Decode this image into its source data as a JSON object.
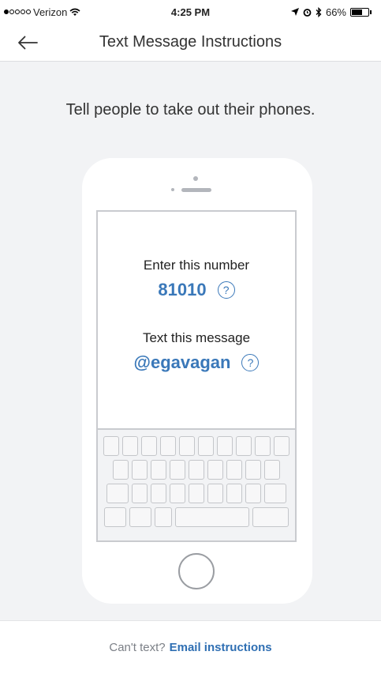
{
  "status_bar": {
    "carrier": "Verizon",
    "time": "4:25 PM",
    "battery": "66%"
  },
  "nav": {
    "title": "Text Message Instructions"
  },
  "headline": "Tell people to take out their phones.",
  "instructions": {
    "number_label": "Enter this number",
    "number_value": "81010",
    "message_label": "Text this message",
    "message_value": "@egavagan",
    "help_glyph": "?"
  },
  "footer": {
    "prompt": "Can't text?",
    "link": "Email instructions"
  },
  "icons": {
    "back": "back-arrow-icon",
    "help": "question-circle-icon",
    "wifi": "wifi-icon",
    "location": "location-arrow-icon",
    "alarm": "alarm-icon",
    "bluetooth": "bluetooth-icon",
    "battery": "battery-icon"
  },
  "colors": {
    "accent": "#3a78b9",
    "link": "#2f6fb3",
    "background": "#f2f3f5"
  }
}
